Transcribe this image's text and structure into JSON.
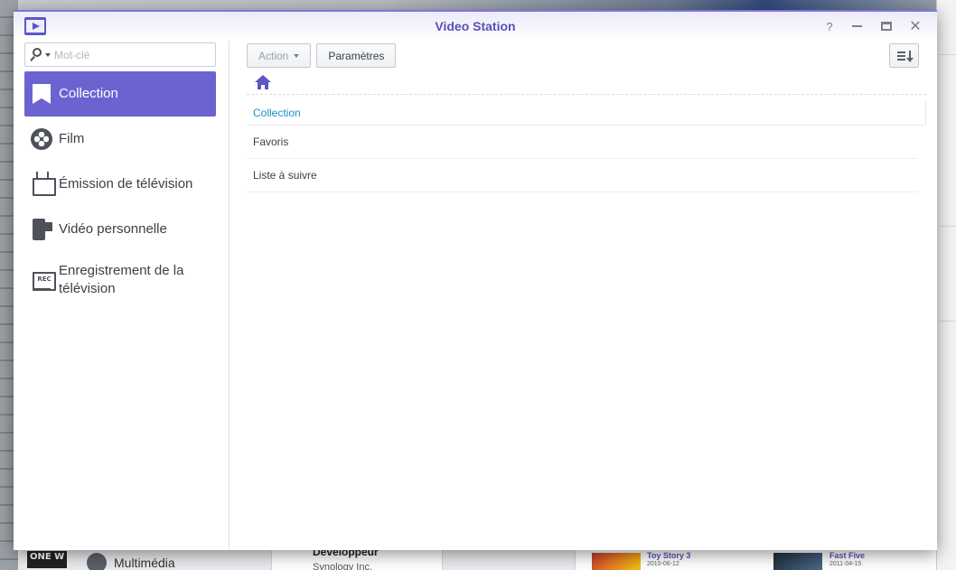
{
  "window": {
    "title": "Video Station"
  },
  "search": {
    "placeholder": "Mot-clé"
  },
  "sidebar": {
    "items": [
      {
        "label": "Collection",
        "icon": "bookmark-icon",
        "active": true
      },
      {
        "label": "Film",
        "icon": "film-reel-icon",
        "active": false
      },
      {
        "label": "Émission de télévision",
        "icon": "tv-icon",
        "active": false
      },
      {
        "label": "Vidéo personnelle",
        "icon": "camcorder-icon",
        "active": false
      },
      {
        "label": "Enregistrement de la télévision",
        "icon": "rec-tv-icon",
        "active": false
      }
    ]
  },
  "toolbar": {
    "action_label": "Action",
    "settings_label": "Paramètres"
  },
  "list": {
    "header": "Collection",
    "rows": [
      "Favoris",
      "Liste à suivre"
    ]
  },
  "background": {
    "multimedia_label": "Multimédia",
    "developer_label": "Développeur",
    "developer_name": "Synology Inc.",
    "street_sign": "ONE W",
    "movies": [
      {
        "title": "Toy Story 3",
        "date": "2010-06-12"
      },
      {
        "title": "Fast Five",
        "date": "2011-04-15"
      }
    ]
  },
  "colors": {
    "accent": "#6c63d1",
    "title_text": "#5750b8",
    "link": "#1a8fcb"
  }
}
